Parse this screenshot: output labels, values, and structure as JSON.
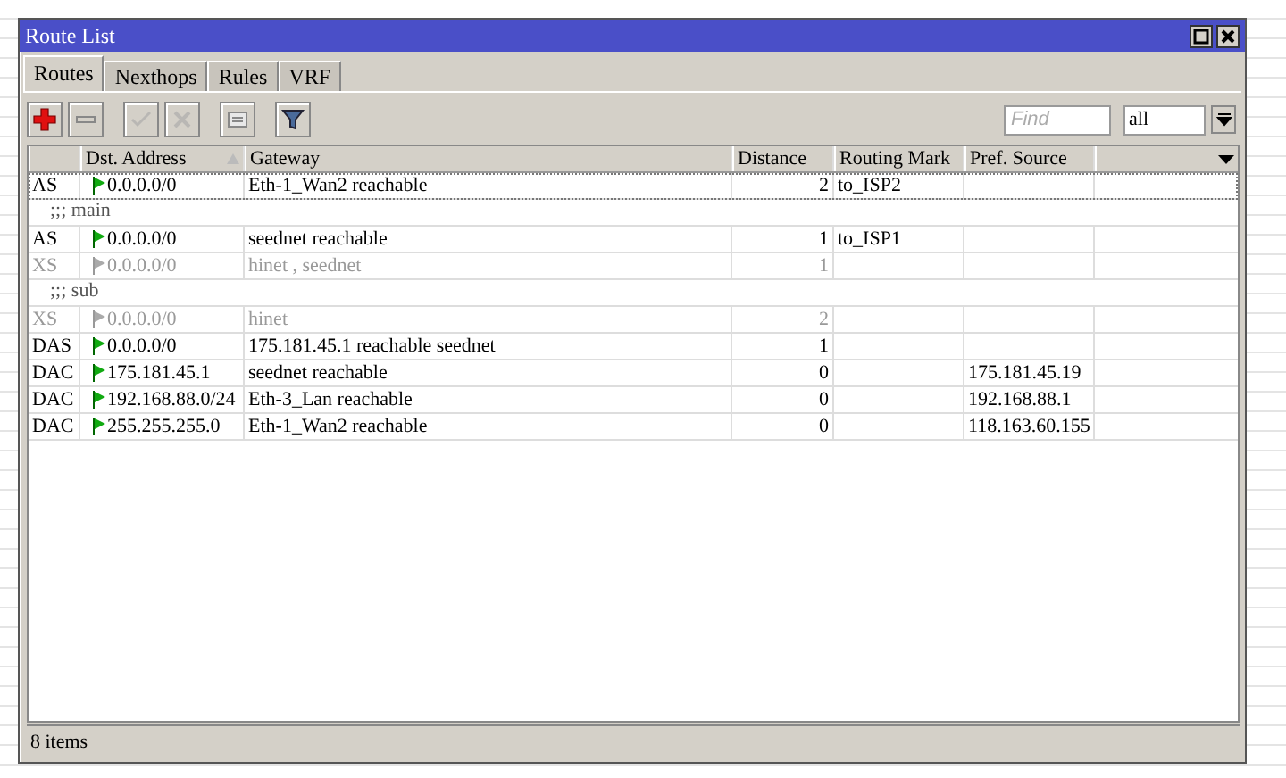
{
  "window": {
    "title": "Route List"
  },
  "tabs": [
    {
      "label": "Routes",
      "selected": true
    },
    {
      "label": "Nexthops",
      "selected": false
    },
    {
      "label": "Rules",
      "selected": false
    },
    {
      "label": "VRF",
      "selected": false
    }
  ],
  "toolbar": {
    "buttons": [
      {
        "kind": "add",
        "disabled": false
      },
      {
        "kind": "remove",
        "disabled": false
      },
      {
        "kind": "enable",
        "disabled": true
      },
      {
        "kind": "disable",
        "disabled": true
      },
      {
        "kind": "comment",
        "disabled": false
      },
      {
        "kind": "filter",
        "disabled": false
      }
    ],
    "find": {
      "placeholder": "Find"
    },
    "filter_select": {
      "value": "all"
    }
  },
  "table": {
    "columns": [
      "",
      "Dst. Address",
      "Gateway",
      "Distance",
      "Routing Mark",
      "Pref. Source",
      ""
    ],
    "rows": [
      {
        "kind": "route",
        "flags": "AS",
        "dst": "0.0.0.0/0",
        "gateway": "Eth-1_Wan2 reachable",
        "distance": "2",
        "routing_mark": "to_ISP2",
        "pref_source": "",
        "disabled": false,
        "selected": true
      },
      {
        "kind": "comment",
        "text": ";;; main"
      },
      {
        "kind": "route",
        "flags": "AS",
        "dst": "0.0.0.0/0",
        "gateway": "seednet reachable",
        "distance": "1",
        "routing_mark": "to_ISP1",
        "pref_source": "",
        "disabled": false,
        "selected": false
      },
      {
        "kind": "route",
        "flags": "XS",
        "dst": "0.0.0.0/0",
        "gateway": "hinet , seednet",
        "distance": "1",
        "routing_mark": "",
        "pref_source": "",
        "disabled": true,
        "selected": false
      },
      {
        "kind": "comment",
        "text": ";;; sub"
      },
      {
        "kind": "route",
        "flags": "XS",
        "dst": "0.0.0.0/0",
        "gateway": "hinet",
        "distance": "2",
        "routing_mark": "",
        "pref_source": "",
        "disabled": true,
        "selected": false
      },
      {
        "kind": "route",
        "flags": "DAS",
        "dst": "0.0.0.0/0",
        "gateway": "175.181.45.1 reachable seednet",
        "distance": "1",
        "routing_mark": "",
        "pref_source": "",
        "disabled": false,
        "selected": false
      },
      {
        "kind": "route",
        "flags": "DAC",
        "dst": "175.181.45.1",
        "gateway": "seednet reachable",
        "distance": "0",
        "routing_mark": "",
        "pref_source": "175.181.45.19",
        "disabled": false,
        "selected": false
      },
      {
        "kind": "route",
        "flags": "DAC",
        "dst": "192.168.88.0/24",
        "gateway": "Eth-3_Lan reachable",
        "distance": "0",
        "routing_mark": "",
        "pref_source": "192.168.88.1",
        "disabled": false,
        "selected": false
      },
      {
        "kind": "route",
        "flags": "DAC",
        "dst": "255.255.255.0",
        "gateway": "Eth-1_Wan2 reachable",
        "distance": "0",
        "routing_mark": "",
        "pref_source": "118.163.60.155",
        "disabled": false,
        "selected": false
      }
    ]
  },
  "status_bar": {
    "text": "8 items"
  }
}
